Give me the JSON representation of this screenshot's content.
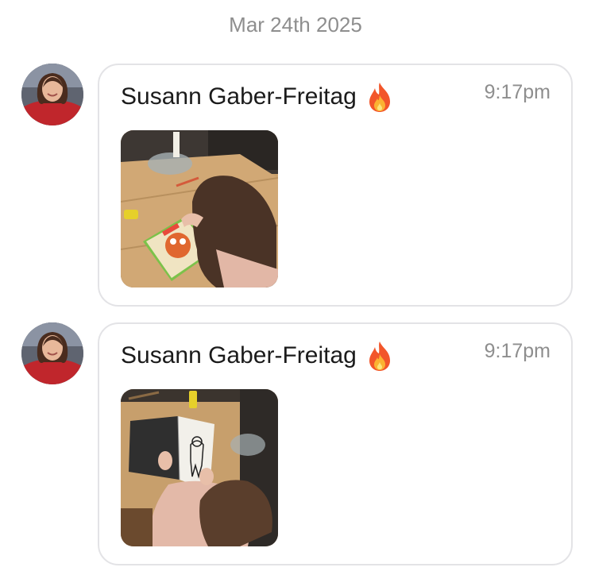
{
  "date_separator": "Mar 24th 2025",
  "messages": [
    {
      "sender": "Susann Gaber-Freitag",
      "reaction_icon": "fire-emoji",
      "time": "9:17pm",
      "attachment": "photo-child-with-sticker-book"
    },
    {
      "sender": "Susann Gaber-Freitag",
      "reaction_icon": "fire-emoji",
      "time": "9:17pm",
      "attachment": "photo-child-drawing-coloring-book"
    }
  ]
}
